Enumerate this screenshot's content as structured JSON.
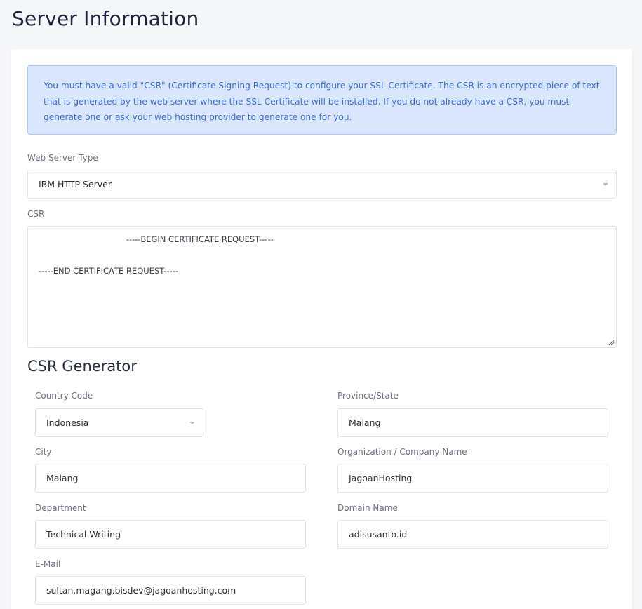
{
  "page": {
    "title": "Server Information"
  },
  "alert": {
    "text": "You must have a valid \"CSR\" (Certificate Signing Request) to configure your SSL Certificate. The CSR is an encrypted piece of text that is generated by the web server where the SSL Certificate will be installed. If you do not already have a CSR, you must generate one or ask your web hosting provider to generate one for you."
  },
  "server_type": {
    "label": "Web Server Type",
    "value": "IBM HTTP Server"
  },
  "csr": {
    "label": "CSR",
    "begin": "-----BEGIN CERTIFICATE REQUEST-----",
    "end": "-----END CERTIFICATE REQUEST-----"
  },
  "generator": {
    "title": "CSR Generator",
    "country": {
      "label": "Country Code",
      "value": "Indonesia"
    },
    "province": {
      "label": "Province/State",
      "value": "Malang"
    },
    "city": {
      "label": "City",
      "value": "Malang"
    },
    "organization": {
      "label": "Organization / Company Name",
      "value": "JagoanHosting"
    },
    "department": {
      "label": "Department",
      "value": "Technical Writing"
    },
    "domain": {
      "label": "Domain Name",
      "value": "adisusanto.id"
    },
    "email": {
      "label": "E-Mail",
      "value": "sultan.magang.bisdev@jagoanhosting.com"
    }
  },
  "colors": {
    "alert_bg": "#d9e6fd",
    "alert_text": "#3f6dd6",
    "page_bg": "#f6f7f9"
  }
}
